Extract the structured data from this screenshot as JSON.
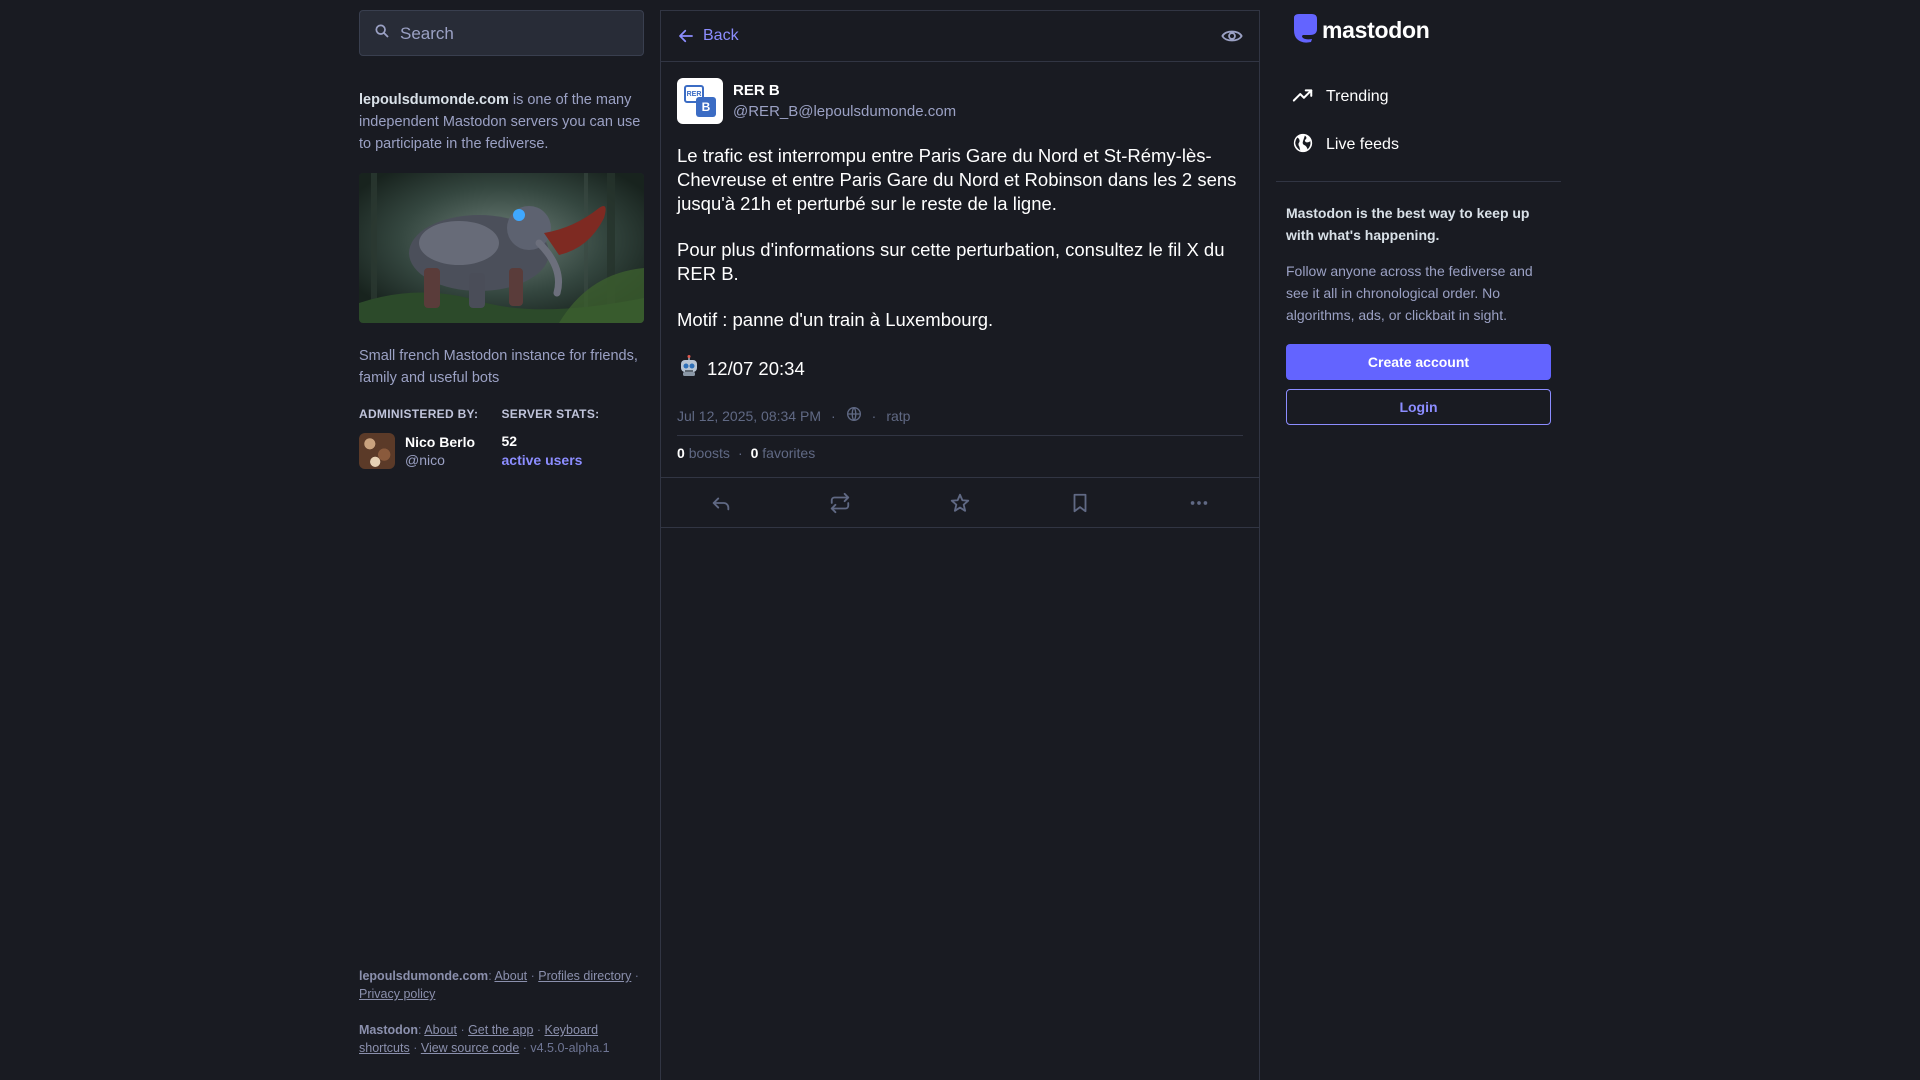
{
  "search": {
    "placeholder": "Search"
  },
  "server": {
    "domain": "lepoulsdumonde.com",
    "about_suffix": " is one of the many independent Mastodon servers you can use to participate in the fediverse.",
    "description": "Small french Mastodon instance for friends, family and useful bots",
    "administered_by_label": "Administered by:",
    "admin_name": "Nico Berlo",
    "admin_handle": "@nico",
    "server_stats_label": "Server stats:",
    "active_users_count": "52",
    "active_users_label": "active users"
  },
  "footer": {
    "server_domain_label": "lepoulsdumonde.com",
    "about": "About",
    "profiles_directory": "Profiles directory",
    "privacy_policy": "Privacy policy",
    "mastodon_label": "Mastodon",
    "mastodon_about": "About",
    "get_the_app": "Get the app",
    "keyboard_shortcuts": "Keyboard shortcuts",
    "view_source_code": "View source code",
    "version": "v4.5.0-alpha.1"
  },
  "column_header": {
    "back_label": "Back"
  },
  "status": {
    "avatar_text_top": "RER",
    "avatar_text_bottom": "B",
    "display_name": "RER B",
    "acct": "@RER_B@lepoulsdumonde.com",
    "paragraphs": [
      "Le trafic est interrompu entre Paris Gare du Nord et St-Rémy-lès-Chevreuse et entre Paris Gare du Nord et Robinson dans les 2 sens jusqu'à 21h et perturbé sur le reste de la ligne.",
      "Pour plus d'informations sur cette perturbation, consultez le fil X du RER B.",
      "Motif : panne d'un train à Luxembourg."
    ],
    "emoji_line": "12/07 20:34",
    "timestamp": "Jul 12, 2025, 08:34 PM",
    "application": "ratp",
    "boosts_count": "0",
    "boosts_label": "boosts",
    "favorites_count": "0",
    "favorites_label": "favorites"
  },
  "nav": {
    "logo": "mastodon",
    "trending": "Trending",
    "live_feeds": "Live feeds"
  },
  "signup": {
    "headline": "Mastodon is the best way to keep up with what's happening.",
    "body": "Follow anyone across the fediverse and see it all in chronological order. No algorithms, ads, or clickbait in sight.",
    "create_account": "Create account",
    "login": "Login"
  },
  "colors": {
    "background": "#191b22",
    "accent": "#8c8dff",
    "primary_button": "#6364ff",
    "border": "#313543"
  },
  "icons": [
    "search-icon",
    "arrow-left-icon",
    "eye-icon",
    "globe-icon",
    "reply-icon",
    "boost-icon",
    "star-icon",
    "bookmark-icon",
    "more-icon",
    "trending-icon",
    "robot-emoji-icon"
  ]
}
